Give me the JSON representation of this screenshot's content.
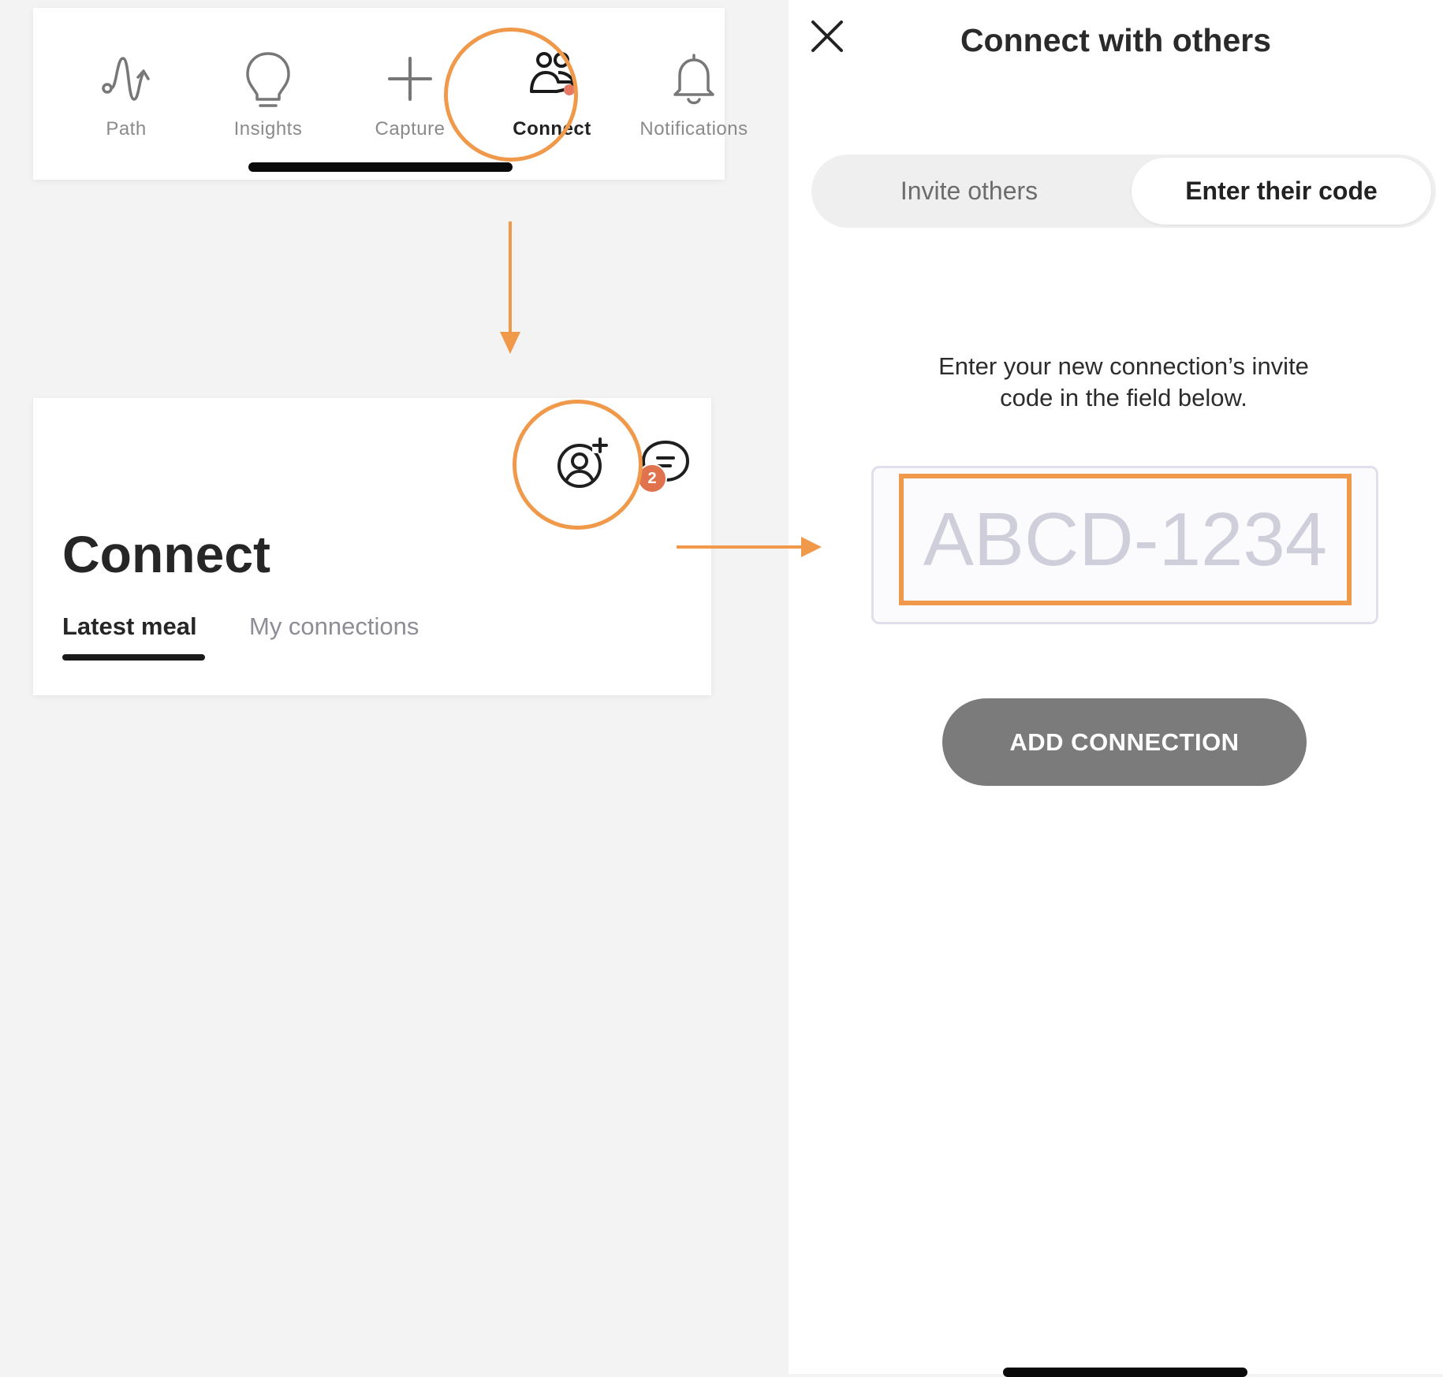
{
  "colors": {
    "highlight": "#f0994a",
    "badge": "#e0734d",
    "button": "#7b7b7b",
    "connect_dot": "#e57863"
  },
  "tabbar": {
    "items": [
      {
        "label": "Path",
        "icon": "path-wave-icon",
        "active": false
      },
      {
        "label": "Insights",
        "icon": "lightbulb-icon",
        "active": false
      },
      {
        "label": "Capture",
        "icon": "plus-icon",
        "active": false
      },
      {
        "label": "Connect",
        "icon": "people-icon",
        "active": true
      },
      {
        "label": "Notifications",
        "icon": "bell-icon",
        "active": false
      }
    ]
  },
  "connect_screen": {
    "title": "Connect",
    "tabs": [
      {
        "label": "Latest meal",
        "active": true
      },
      {
        "label": "My connections",
        "active": false
      }
    ],
    "icons": [
      "add-person-icon",
      "chat-icon"
    ],
    "chat_badge": "2"
  },
  "modal": {
    "title": "Connect with others",
    "segments": [
      {
        "label": "Invite others",
        "active": false
      },
      {
        "label": "Enter their code",
        "active": true
      }
    ],
    "instructions_line1": "Enter your new connection’s invite",
    "instructions_line2": "code in the field below.",
    "code_placeholder": "ABCD-1234",
    "add_button": "ADD CONNECTION"
  }
}
